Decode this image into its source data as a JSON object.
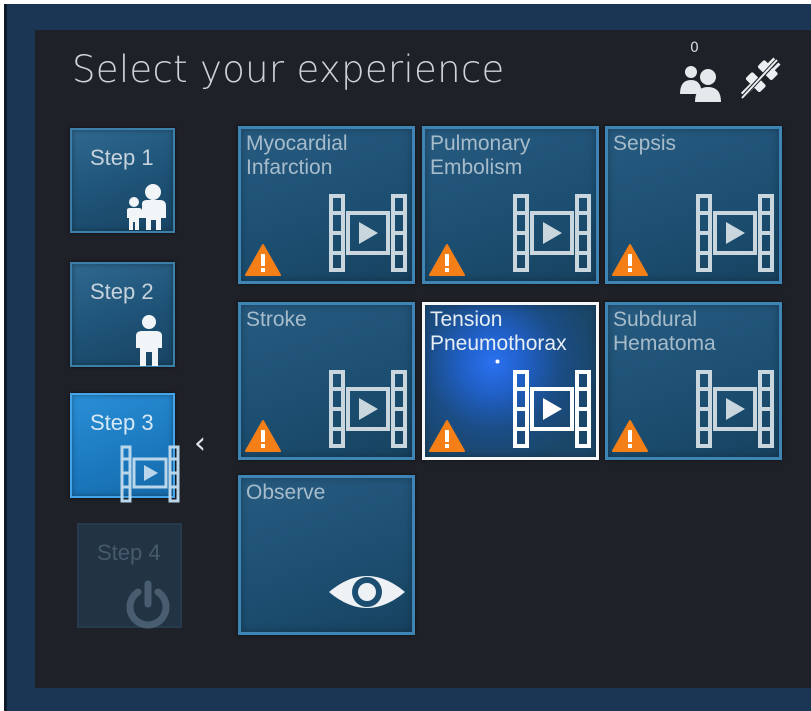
{
  "header": {
    "title": "Select your experience",
    "users_count": "0"
  },
  "steps": [
    {
      "label": "Step 1",
      "icon": "adult-and-child-icon",
      "state": "normal"
    },
    {
      "label": "Step 2",
      "icon": "person-icon",
      "state": "normal"
    },
    {
      "label": "Step 3",
      "icon": "film-play-icon",
      "state": "active"
    },
    {
      "label": "Step 4",
      "icon": "power-icon",
      "state": "disabled"
    }
  ],
  "back_icon": "chevron-left-icon",
  "tiles": [
    {
      "label": "Myocardial\nInfarction",
      "icon": "film-play-icon",
      "warning": true
    },
    {
      "label": "Pulmonary\nEmbolism",
      "icon": "film-play-icon",
      "warning": true
    },
    {
      "label": "Sepsis",
      "icon": "film-play-icon",
      "warning": true
    },
    {
      "label": "Stroke",
      "icon": "film-play-icon",
      "warning": true
    },
    {
      "label": "Tension\nPneumothorax",
      "icon": "film-play-icon",
      "warning": true,
      "selected": true
    },
    {
      "label": "Subdural\nHematoma",
      "icon": "film-play-icon",
      "warning": true
    },
    {
      "label": "Observe",
      "icon": "eye-icon",
      "warning": false
    }
  ],
  "colors": {
    "background": "#1e2127",
    "frame": "#1b3554",
    "tile": "#1c4e71",
    "tile_border": "#3e84b5",
    "active_step": "#1b78be",
    "warning": "#f57f17"
  }
}
